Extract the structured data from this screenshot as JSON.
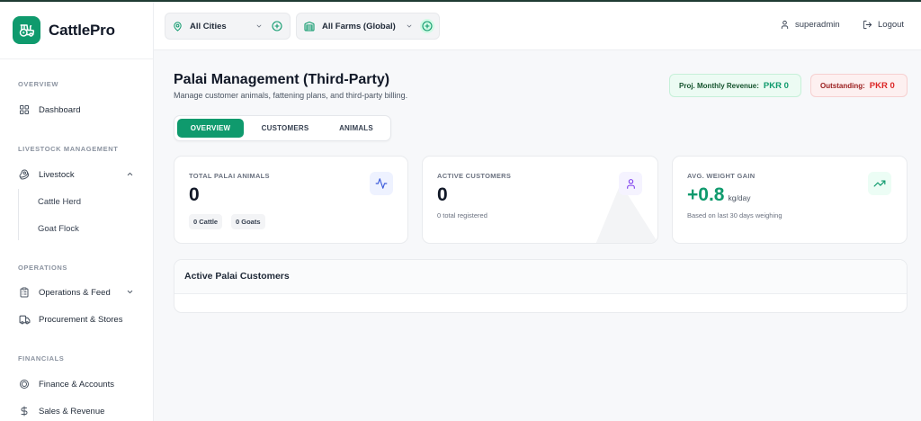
{
  "brand": {
    "name": "CattlePro"
  },
  "sidebar": {
    "sections": {
      "overview": "OVERVIEW",
      "livestock": "LIVESTOCK MANAGEMENT",
      "operations": "OPERATIONS",
      "financials": "FINANCIALS"
    },
    "items": {
      "dashboard": "Dashboard",
      "livestock": "Livestock",
      "cattle_herd": "Cattle Herd",
      "goat_flock": "Goat Flock",
      "operations_feed": "Operations & Feed",
      "procurement": "Procurement & Stores",
      "finance": "Finance & Accounts",
      "sales": "Sales & Revenue"
    }
  },
  "topbar": {
    "city_selector": "All Cities",
    "farm_selector": "All Farms (Global)",
    "user": "superadmin",
    "logout": "Logout"
  },
  "page": {
    "title": "Palai Management (Third-Party)",
    "subtitle": "Manage customer animals, fattening plans, and third-party billing.",
    "revenue_label": "Proj. Monthly Revenue:",
    "revenue_value": "PKR 0",
    "outstanding_label": "Outstanding:",
    "outstanding_value": "PKR 0"
  },
  "tabs": [
    "OVERVIEW",
    "CUSTOMERS",
    "ANIMALS"
  ],
  "stats": {
    "animals": {
      "label": "TOTAL PALAI ANIMALS",
      "value": "0",
      "cattle_tag": "0 Cattle",
      "goats_tag": "0 Goats"
    },
    "customers": {
      "label": "ACTIVE CUSTOMERS",
      "value": "0",
      "hint": "0 total registered"
    },
    "weight": {
      "label": "AVG. WEIGHT GAIN",
      "value": "+0.8",
      "unit": "kg/day",
      "hint": "Based on last 30 days weighing"
    }
  },
  "customers_panel": {
    "title": "Active Palai Customers"
  },
  "colors": {
    "accent": "#0f9a6d",
    "danger": "#dc2626",
    "purple": "#7c3aed",
    "blue": "#3b5bdb"
  }
}
